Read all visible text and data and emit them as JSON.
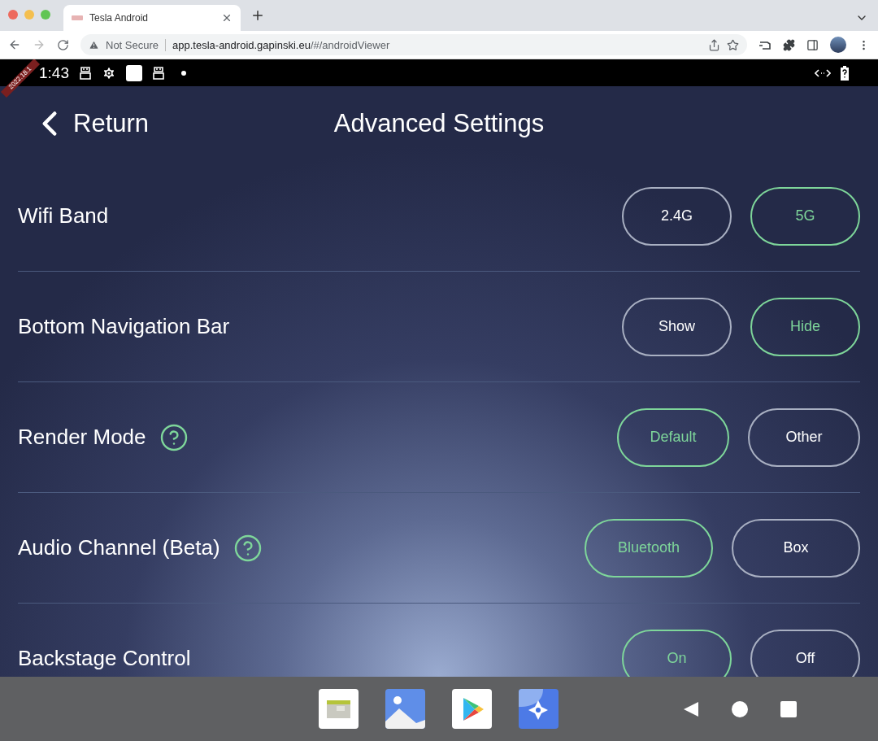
{
  "browser": {
    "tab_title": "Tesla Android",
    "security_label": "Not Secure",
    "url_host": "app.tesla-android.gapinski.eu",
    "url_path": "/#/androidViewer"
  },
  "status_bar": {
    "time": "1:43",
    "version_ribbon": "2022.18.1"
  },
  "header": {
    "back_label": "Return",
    "title": "Advanced Settings"
  },
  "settings": [
    {
      "label": "Wifi Band",
      "help": false,
      "options": [
        {
          "label": "2.4G",
          "selected": false
        },
        {
          "label": "5G",
          "selected": true
        }
      ]
    },
    {
      "label": "Bottom Navigation Bar",
      "help": false,
      "options": [
        {
          "label": "Show",
          "selected": false
        },
        {
          "label": "Hide",
          "selected": true
        }
      ]
    },
    {
      "label": "Render Mode",
      "help": true,
      "options": [
        {
          "label": "Default",
          "selected": true
        },
        {
          "label": "Other",
          "selected": false
        }
      ]
    },
    {
      "label": "Audio Channel (Beta)",
      "help": true,
      "options": [
        {
          "label": "Bluetooth",
          "selected": true
        },
        {
          "label": "Box",
          "selected": false
        }
      ]
    },
    {
      "label": "Backstage Control",
      "help": false,
      "options": [
        {
          "label": "On",
          "selected": true
        },
        {
          "label": "Off",
          "selected": false
        }
      ]
    }
  ]
}
